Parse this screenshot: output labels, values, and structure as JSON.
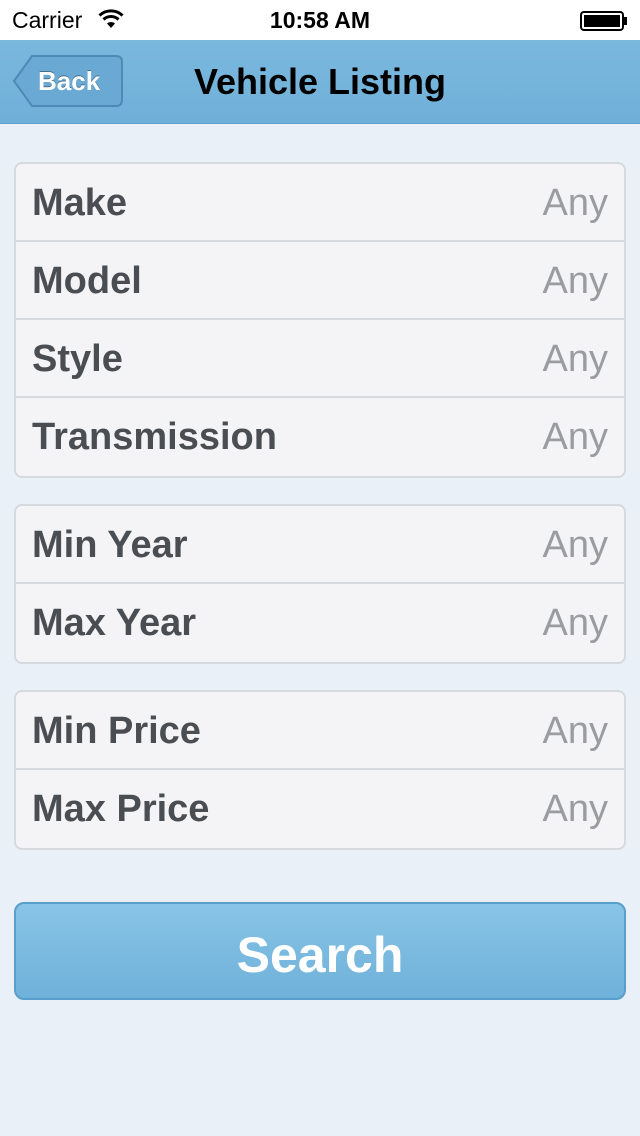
{
  "status_bar": {
    "carrier": "Carrier",
    "time": "10:58 AM",
    "wifi_icon": "wifi-icon",
    "battery_icon": "battery-icon"
  },
  "nav": {
    "back_label": "Back",
    "title": "Vehicle Listing"
  },
  "groups": [
    {
      "rows": [
        {
          "label": "Make",
          "value": "Any"
        },
        {
          "label": "Model",
          "value": "Any"
        },
        {
          "label": "Style",
          "value": "Any"
        },
        {
          "label": "Transmission",
          "value": "Any"
        }
      ]
    },
    {
      "rows": [
        {
          "label": "Min Year",
          "value": "Any"
        },
        {
          "label": "Max Year",
          "value": "Any"
        }
      ]
    },
    {
      "rows": [
        {
          "label": "Min Price",
          "value": "Any"
        },
        {
          "label": "Max Price",
          "value": "Any"
        }
      ]
    }
  ],
  "search": {
    "label": "Search"
  },
  "colors": {
    "nav_bar": "#75b4db",
    "background": "#eaf0f8",
    "row_label": "#4a4d52",
    "row_value": "#9a9ca0",
    "search_button": "#7bbbe0"
  }
}
